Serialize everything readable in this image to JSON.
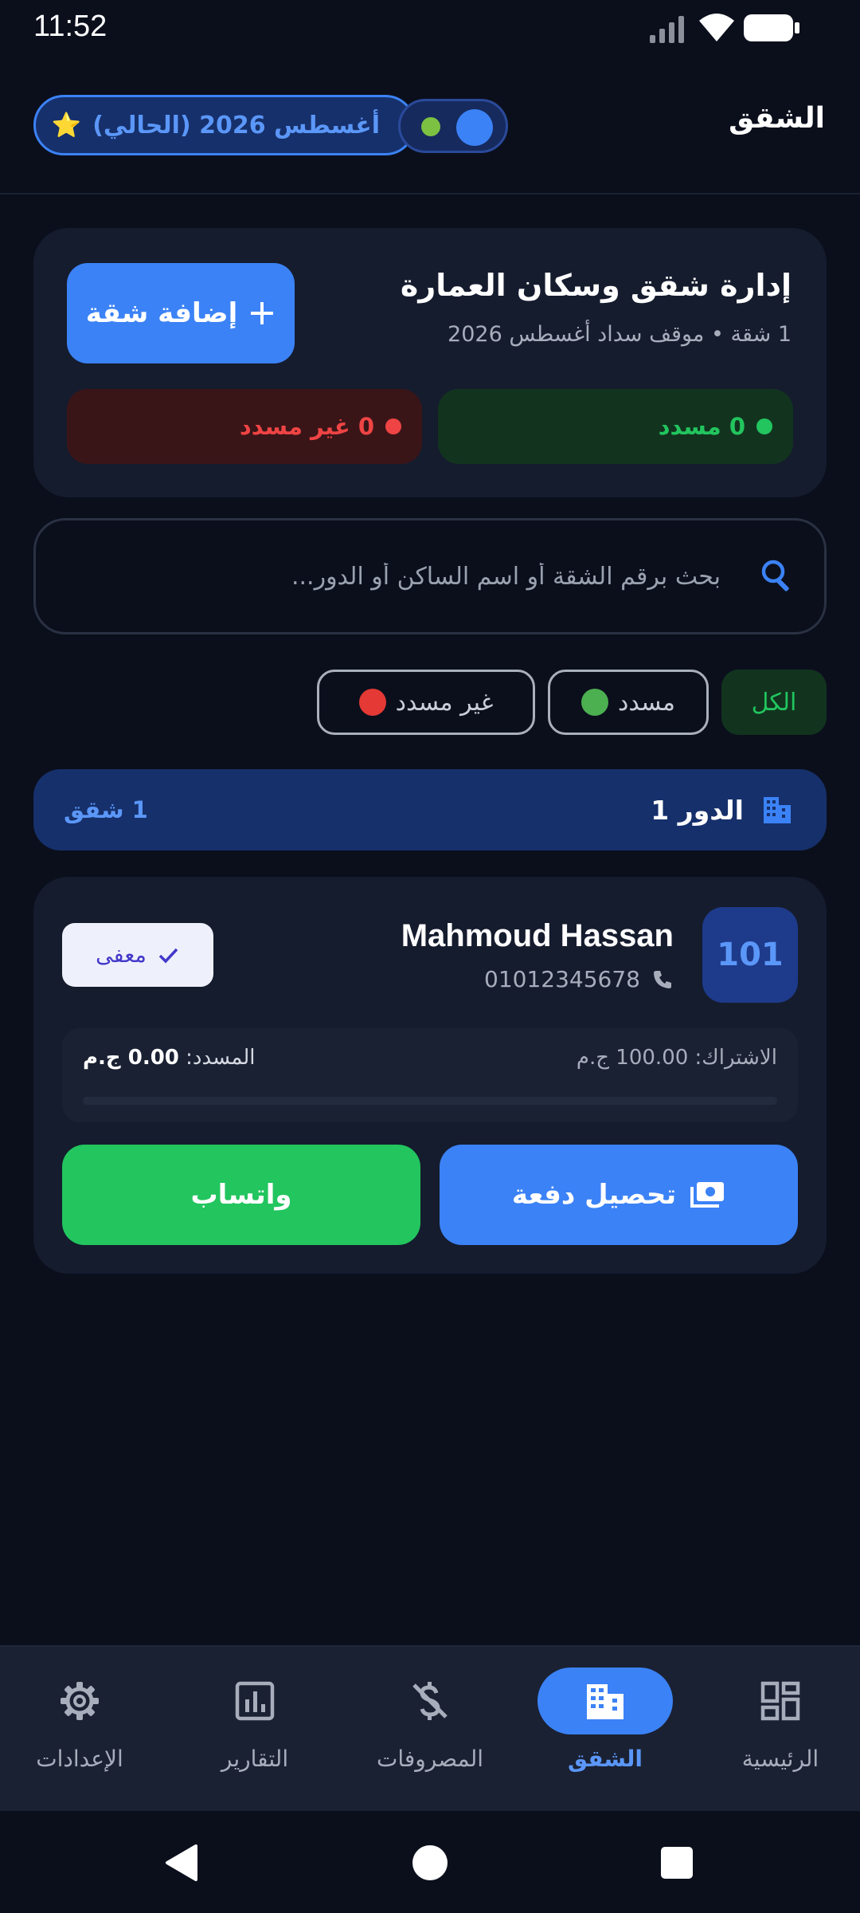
{
  "status_bar": {
    "time": "11:52"
  },
  "header": {
    "title": "الشقق",
    "month_selector": {
      "label": "أغسطس 2026 (الحالي)",
      "star": "⭐"
    }
  },
  "summary": {
    "title": "إدارة شقق وسكان العمارة",
    "subtitle": "1 شقة • موقف سداد أغسطس 2026",
    "add_button": "إضافة شقة",
    "paid_stat": "0 مسدد",
    "unpaid_stat": "0 غير مسدد",
    "colors": {
      "paid": "#22c55e",
      "unpaid": "#ef4444",
      "accent": "#3b82f6"
    }
  },
  "search": {
    "placeholder": "بحث برقم الشقة أو اسم الساكن أو الدور..."
  },
  "filters": {
    "all": "الكل",
    "paid": "مسدد",
    "unpaid": "غير مسدد",
    "active": "all"
  },
  "floors": [
    {
      "label": "الدور 1",
      "count": "1 شقق",
      "apartments": [
        {
          "number": "101",
          "tenant_name": "Mahmoud Hassan",
          "phone": "01012345678",
          "badge": "معفى",
          "subscription_label": "الاشتراك:",
          "subscription_value": "100.00 ج.م",
          "paid_label": "المسدد:",
          "paid_value": "0.00 ج.م",
          "paid_fraction": 0,
          "collect_button": "تحصيل دفعة",
          "whatsapp_button": "واتساب"
        }
      ]
    }
  ],
  "bottom_nav": {
    "active": "apartments",
    "items": [
      {
        "key": "settings",
        "label": "الإعدادات",
        "icon": "gear-icon"
      },
      {
        "key": "reports",
        "label": "التقارير",
        "icon": "chart-icon"
      },
      {
        "key": "expenses",
        "label": "المصروفات",
        "icon": "money-off-icon"
      },
      {
        "key": "apartments",
        "label": "الشقق",
        "icon": "building-icon"
      },
      {
        "key": "home",
        "label": "الرئيسية",
        "icon": "dashboard-icon"
      }
    ]
  }
}
